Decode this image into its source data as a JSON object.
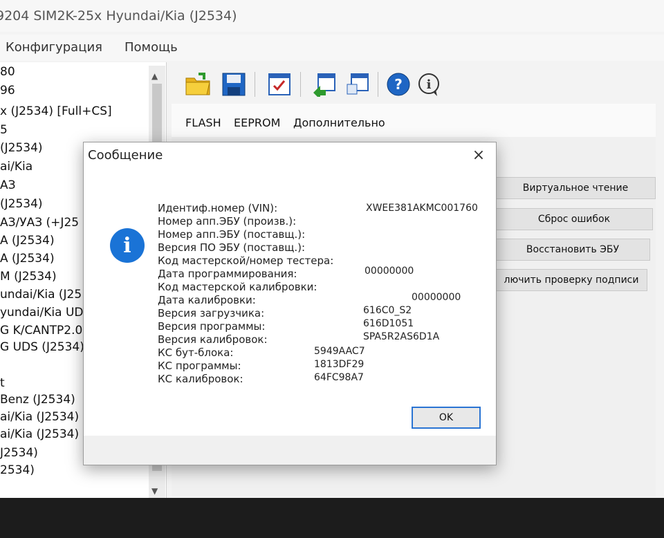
{
  "window": {
    "title": "9204 SIM2K-25x Hyundai/Kia (J2534)"
  },
  "menu": {
    "items": [
      "Конфигурация",
      "Помощь"
    ]
  },
  "tree": {
    "items": [
      "80",
      "96",
      "x (J2534) [Full+CS]",
      "5",
      "(J2534)",
      "ai/Kia",
      "АЗ",
      "(J2534)",
      "АЗ/УАЗ (+J25",
      "А (J2534)",
      "А (J2534)",
      "М (J2534)",
      "undai/Kia (J25",
      "yundai/Kia UDS",
      "G K/CANTP2.0",
      "G UDS (J2534)",
      "t",
      "Benz (J2534)",
      "ai/Kia (J2534)",
      "ai/Kia (J2534)",
      "J2534)",
      "2534)"
    ]
  },
  "toolbar": {
    "icons": [
      "open-folder-icon",
      "save-icon",
      "checklist-icon",
      "ecu-read-icon",
      "ecu-write-icon",
      "help-icon",
      "info-icon"
    ]
  },
  "tabs": [
    "FLASH",
    "EEPROM",
    "Дополнительно"
  ],
  "side_buttons": [
    "Виртуальное чтение",
    "Сброс ошибок",
    "Восстановить ЭБУ",
    "лючить проверку подписи"
  ],
  "dialog": {
    "title": "Сообщение",
    "close": "×",
    "icon": "information-icon",
    "icon_glyph": "i",
    "fields": [
      {
        "label": "Идентиф.номер (VIN):",
        "value": "XWEE381AKMC001760"
      },
      {
        "label": "Номер апп.ЭБУ (произв.):",
        "value": ""
      },
      {
        "label": "Номер апп.ЭБУ (поставщ.):",
        "value": ""
      },
      {
        "label": "Версия ПО ЭБУ (поставщ.):",
        "value": ""
      },
      {
        "label": "Код мастерской/номер тестера:",
        "value": ""
      },
      {
        "label": "Дата программирования:",
        "value": "00000000"
      },
      {
        "label": "Код мастерской калибровки:",
        "value": "00000000"
      },
      {
        "label": "Дата калибровки:",
        "value": "616C0_S2"
      },
      {
        "label": "Версия загрузчика:",
        "value": "616D1051"
      },
      {
        "label": "Версия программы:",
        "value": "SPA5R2AS6D1A"
      },
      {
        "label": "Версия калибровок:",
        "value": ""
      },
      {
        "label": "КС бут-блока:",
        "value": "5949AAC7"
      },
      {
        "label": "КС программы:",
        "value": "1813DF29"
      },
      {
        "label": "КС калибровок:",
        "value": "64FC98A7"
      }
    ],
    "ok_label": "OK"
  }
}
